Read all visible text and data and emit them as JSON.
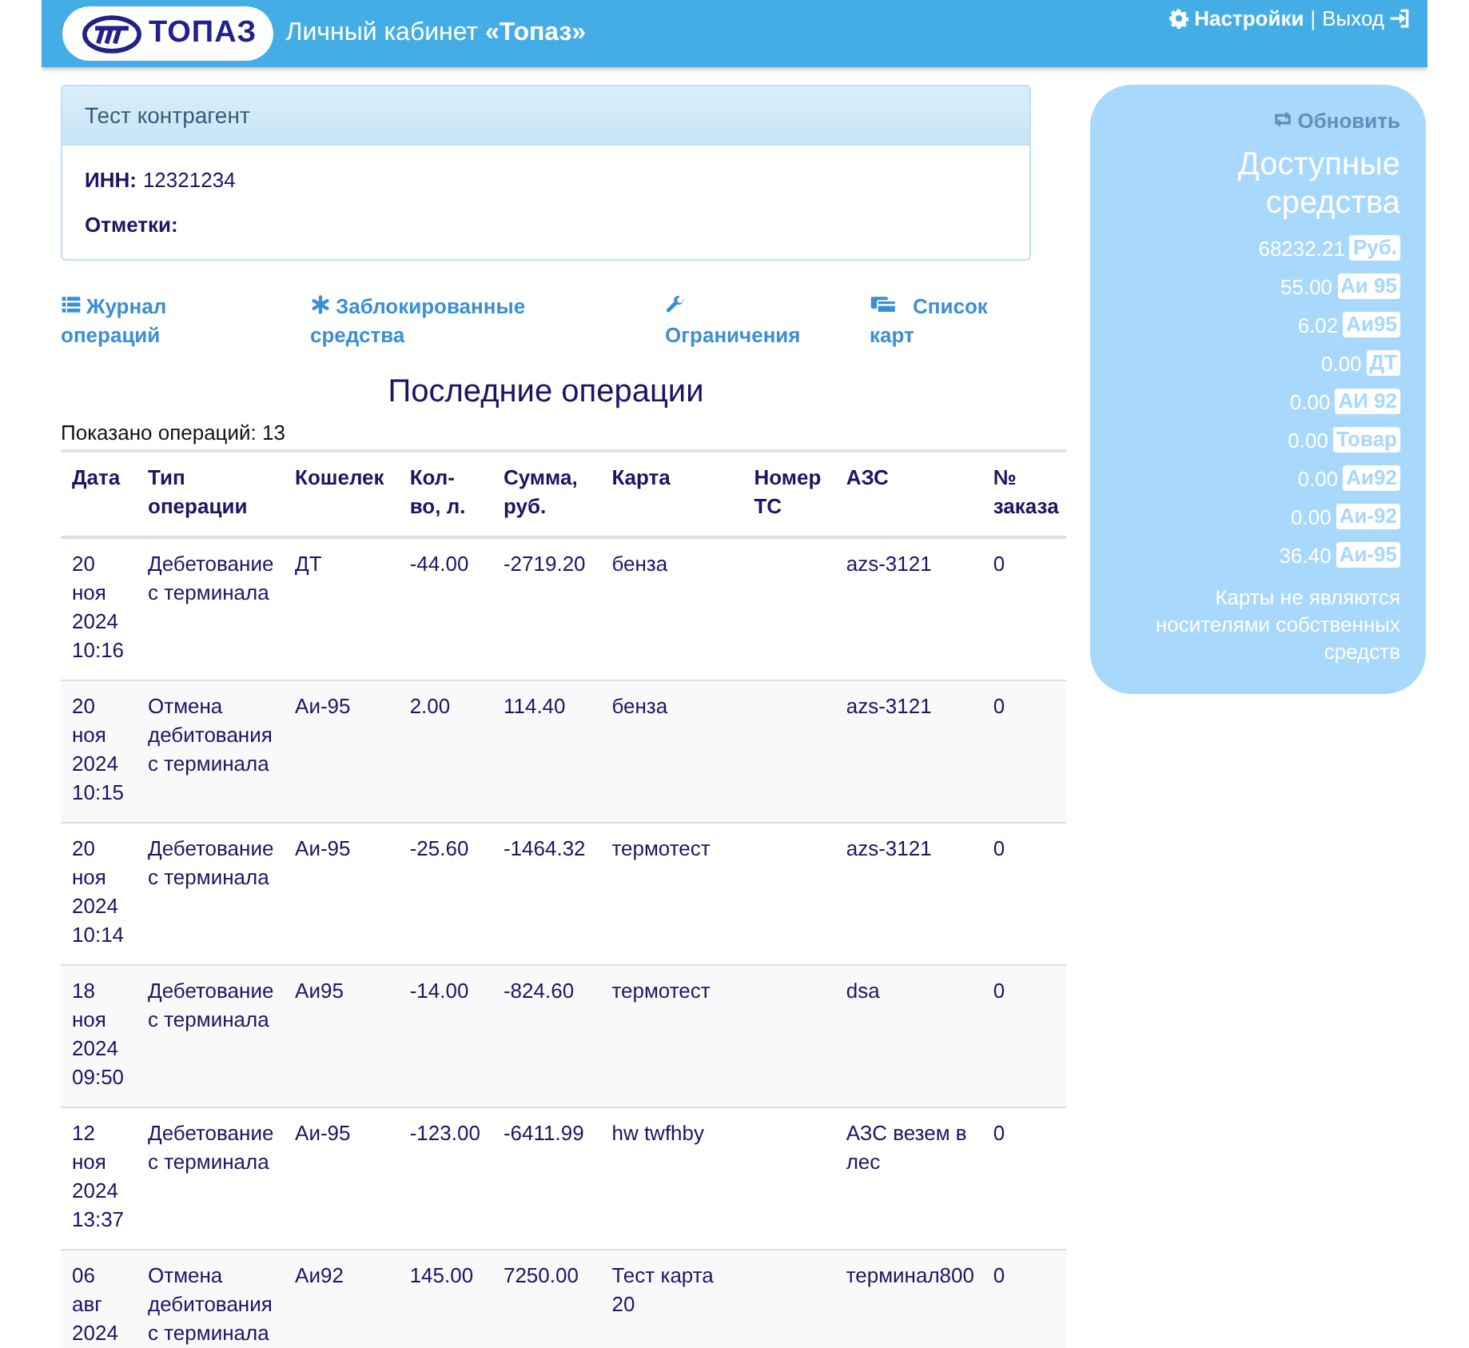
{
  "header": {
    "logo_text": "ТОПАЗ",
    "title": "Личный кабинет **«Топаз»**",
    "links": [
      {
        "kind": "settings",
        "label": "Настройки"
      },
      {
        "kind": "logout",
        "label": "Выход"
      }
    ],
    "separator": "|"
  },
  "account": {
    "title": "Тест контрагент",
    "fields": [
      {
        "label": "ИНН:",
        "value": "12321234"
      },
      {
        "label": "Отметки:"
      }
    ]
  },
  "nav": [
    {
      "kind": "list",
      "label": "Журнал операций"
    },
    {
      "kind": "asterisk",
      "label": "Заблокированные средства"
    },
    {
      "kind": "wrench",
      "label": "Ограничения"
    },
    {
      "kind": "cards",
      "label": "Список карт"
    }
  ],
  "section_title": "Последние операции",
  "count_text": "Показано операций: 13",
  "table": {
    "columns": [
      "Дата",
      "Тип операции",
      "Кошелек",
      "Кол-во, л.",
      "Сумма, руб.",
      "Карта",
      "Номер ТС",
      "АЗС",
      "№ заказа"
    ],
    "rows": [
      [
        "20 ноя 2024 10:16",
        "Дебетование с терминала",
        "ДТ",
        "-44.00",
        "-2719.20",
        "бенза",
        "",
        "azs-3121",
        "0"
      ],
      [
        "20 ноя 2024 10:15",
        "Отмена дебитования с терминала",
        "Аи-95",
        "2.00",
        "114.40",
        "бенза",
        "",
        "azs-3121",
        "0"
      ],
      [
        "20 ноя 2024 10:14",
        "Дебетование с терминала",
        "Аи-95",
        "-25.60",
        "-1464.32",
        "термотест",
        "",
        "azs-3121",
        "0"
      ],
      [
        "18 ноя 2024 09:50",
        "Дебетование с терминала",
        "Аи95",
        "-14.00",
        "-824.60",
        "термотест",
        "",
        "dsa",
        "0"
      ],
      [
        "12 ноя 2024 13:37",
        "Дебетование с терминала",
        "Аи-95",
        "-123.00",
        "-6411.99",
        "hw twfhby",
        "",
        "АЗС везем в лес",
        "0"
      ],
      [
        "06 авг 2024",
        "Отмена дебитования с терминала",
        "Аи92",
        "145.00",
        "7250.00",
        "Тест карта 20",
        "",
        "терминал800",
        "0"
      ]
    ]
  },
  "sidebar": {
    "refresh": "Обновить",
    "title": "Доступные средства",
    "balances": [
      {
        "amount": "68232.21",
        "unit": "Руб."
      },
      {
        "amount": "55.00",
        "unit": "Аи 95"
      },
      {
        "amount": "6.02",
        "unit": "Аи95"
      },
      {
        "amount": "0.00",
        "unit": "ДТ"
      },
      {
        "amount": "0.00",
        "unit": "АИ 92"
      },
      {
        "amount": "0.00",
        "unit": "Товар"
      },
      {
        "amount": "0.00",
        "unit": "Аи92"
      },
      {
        "amount": "0.00",
        "unit": "Аи-92"
      },
      {
        "amount": "36.40",
        "unit": "Аи-95"
      }
    ],
    "note": "Карты не являются носителями собственных средств"
  }
}
